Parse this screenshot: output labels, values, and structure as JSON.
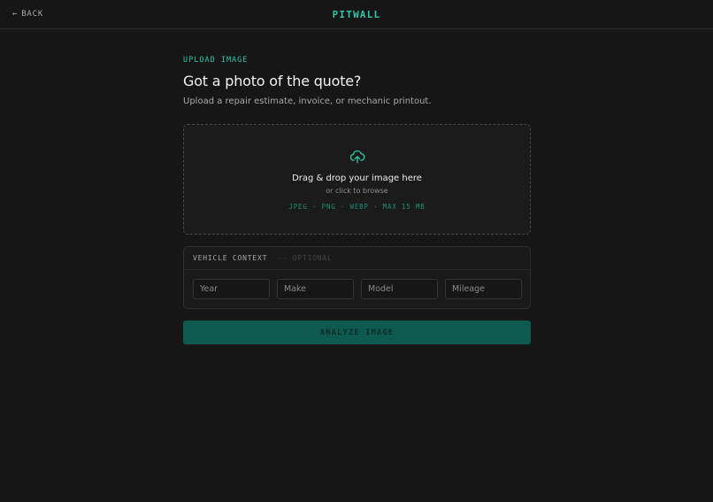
{
  "header": {
    "back_label": "BACK",
    "brand": "PITWALL"
  },
  "main": {
    "eyebrow": "UPLOAD IMAGE",
    "title": "Got a photo of the quote?",
    "subtitle": "Upload a repair estimate, invoice, or mechanic printout."
  },
  "dropzone": {
    "icon": "cloud-upload-icon",
    "title": "Drag & drop your image here",
    "subtitle": "or click to browse",
    "types": "JPEG · PNG · WEBP · MAX 15 MB"
  },
  "vehicle_context": {
    "label": "VEHICLE CONTEXT",
    "optional": "-- OPTIONAL",
    "fields": {
      "year": {
        "value": "",
        "placeholder": "Year"
      },
      "make": {
        "value": "",
        "placeholder": "Make"
      },
      "model": {
        "value": "",
        "placeholder": "Model"
      },
      "mileage": {
        "value": "",
        "placeholder": "Mileage"
      }
    }
  },
  "actions": {
    "analyze_label": "ANALYZE IMAGE"
  },
  "colors": {
    "background": "#161616",
    "accent": "#2fc7a8",
    "button": "#0f5a50"
  }
}
